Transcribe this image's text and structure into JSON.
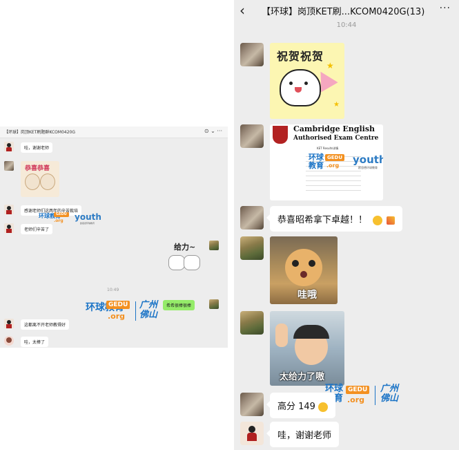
{
  "left": {
    "header_title": "【环球】岗顶KET刷题群KCOM0420G",
    "header_icons": "⊙ ⌄  ···",
    "messages": [
      "哇，谢谢老师",
      "恭喜恭喜",
      "感谢老师们这两年的辛苦栽培",
      "老师们辛苦了",
      "给力~",
      "10:49",
      "希希很棒很棒",
      "这都离不开老师教得好",
      "哇，太棒了"
    ],
    "logo": {
      "cn": "环球教育",
      "gedu": "GEDU",
      "org": ".org",
      "youth": "youth",
      "youth_sub": "欧思德环球教育",
      "city": "广州佛山"
    }
  },
  "right": {
    "back_label": "‹",
    "title": "【环球】岗顶KET刷...KCOM0420G(13)",
    "more_label": "···",
    "time": "10:44",
    "sticker1_text": "祝贺祝贺",
    "cambridge": {
      "line1": "Cambridge English",
      "line2": "Authorised  Exam Centre",
      "table_title": "KET Results详情"
    },
    "msg_congrats": "恭喜昭希拿下卓越！！",
    "cat_text": "哇哦",
    "kid_text": "太给力了嗷",
    "msg_score": "高分 149",
    "msg_thanks": "哇，谢谢老师",
    "logo": {
      "cn1": "环球",
      "cn2": "教育",
      "gedu": "GEDU",
      "org": ".org",
      "city1": "广州",
      "city2": "佛山",
      "youth": "youth",
      "youth_sub": "欧思德环球教育"
    }
  },
  "colors": {
    "wechat_green": "#95ec69",
    "chat_bg": "#ededed",
    "logo_blue": "#1a73c6",
    "logo_orange": "#f39020"
  }
}
